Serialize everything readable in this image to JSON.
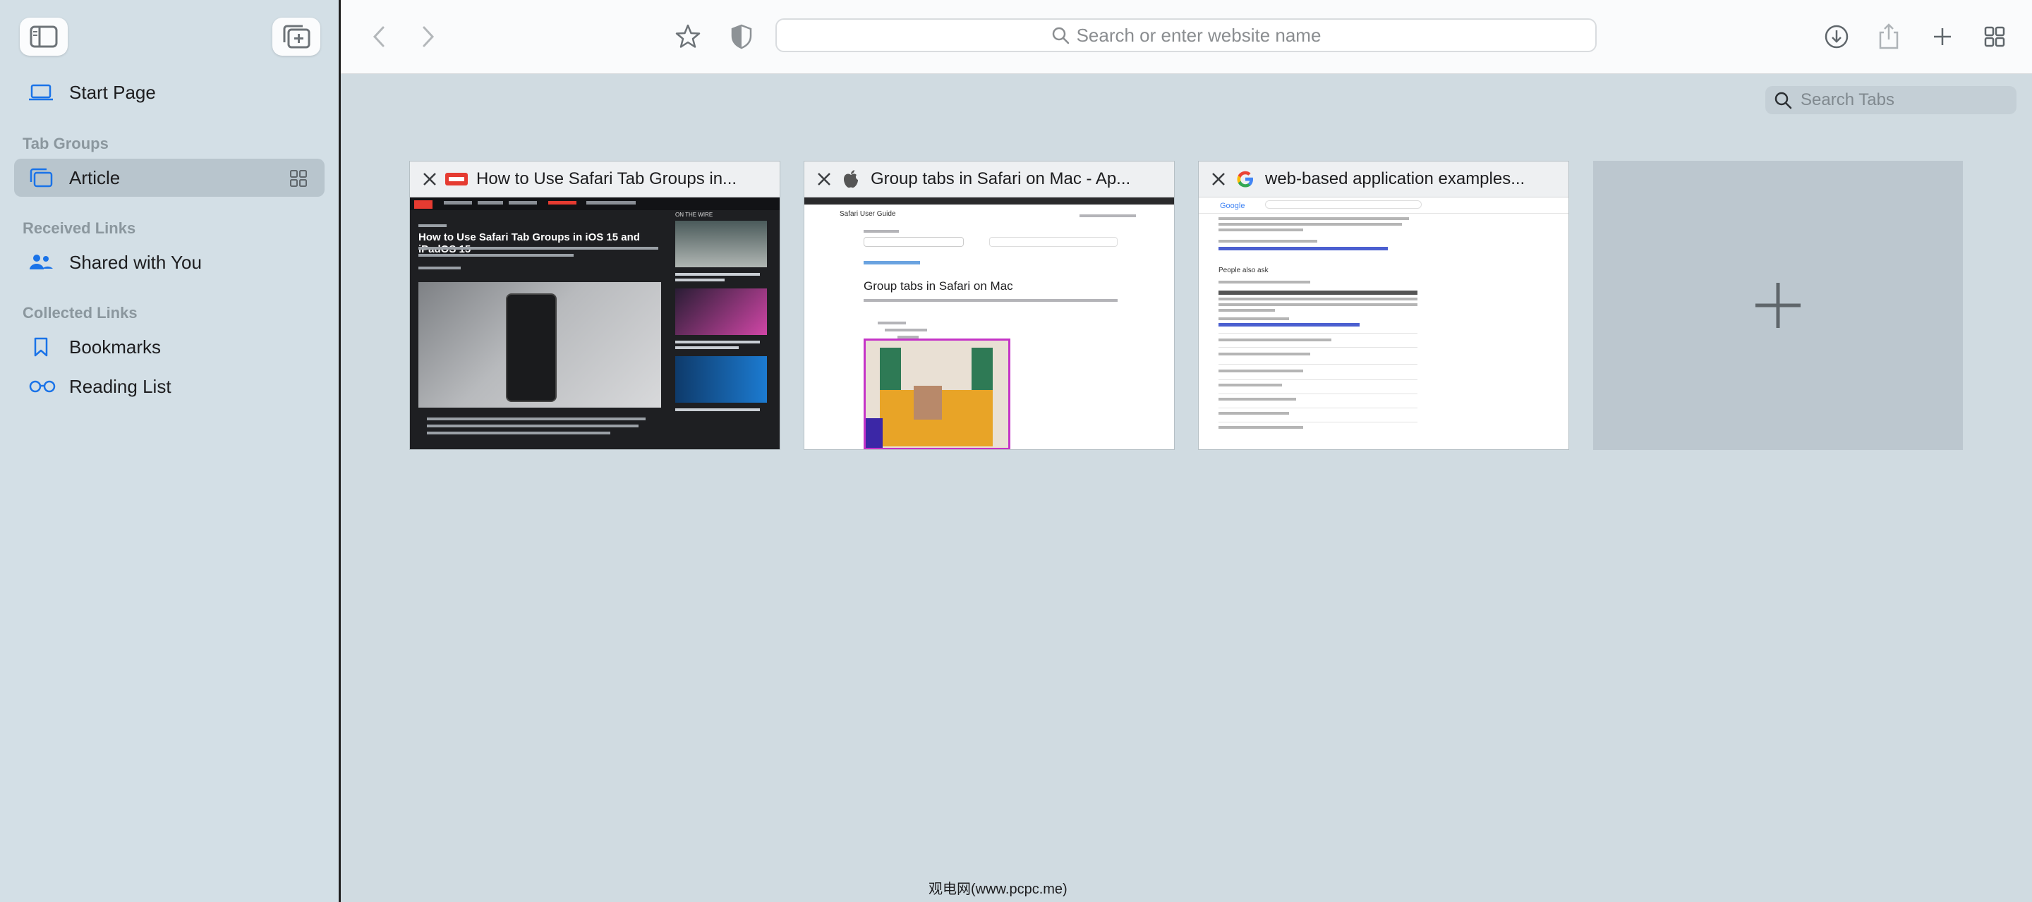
{
  "sidebar": {
    "items": [
      {
        "label": "Start Page",
        "icon": "laptop-icon"
      },
      {
        "label": "Article",
        "icon": "tab-group-icon",
        "selected": true
      },
      {
        "label": "Shared with You",
        "icon": "people-icon"
      },
      {
        "label": "Bookmarks",
        "icon": "bookmark-icon"
      },
      {
        "label": "Reading List",
        "icon": "glasses-icon"
      }
    ],
    "sections": {
      "tab_groups": "Tab Groups",
      "received_links": "Received Links",
      "collected_links": "Collected Links"
    }
  },
  "toolbar": {
    "url_placeholder": "Search or enter website name"
  },
  "search_tabs": {
    "placeholder": "Search Tabs"
  },
  "tabs": [
    {
      "title": "How to Use Safari Tab Groups in...",
      "favicon": "mte-favicon",
      "thumb_headline": "How to Use Safari Tab Groups in iOS 15 and iPadOS 15",
      "thumb_side": "ON THE WIRE"
    },
    {
      "title": "Group tabs in Safari on Mac - Ap...",
      "favicon": "apple-favicon",
      "thumb_heading": "Group tabs in Safari on Mac",
      "thumb_guide": "Safari User Guide"
    },
    {
      "title": "web-based application examples...",
      "favicon": "google-favicon",
      "thumb_logo": "Google",
      "thumb_section": "People also ask"
    }
  ],
  "watermark": "观电网(www.pcpc.me)",
  "colors": {
    "accent": "#1a73e8",
    "sidebar_bg": "#d3dfe6",
    "content_bg": "#d0dbe1"
  }
}
